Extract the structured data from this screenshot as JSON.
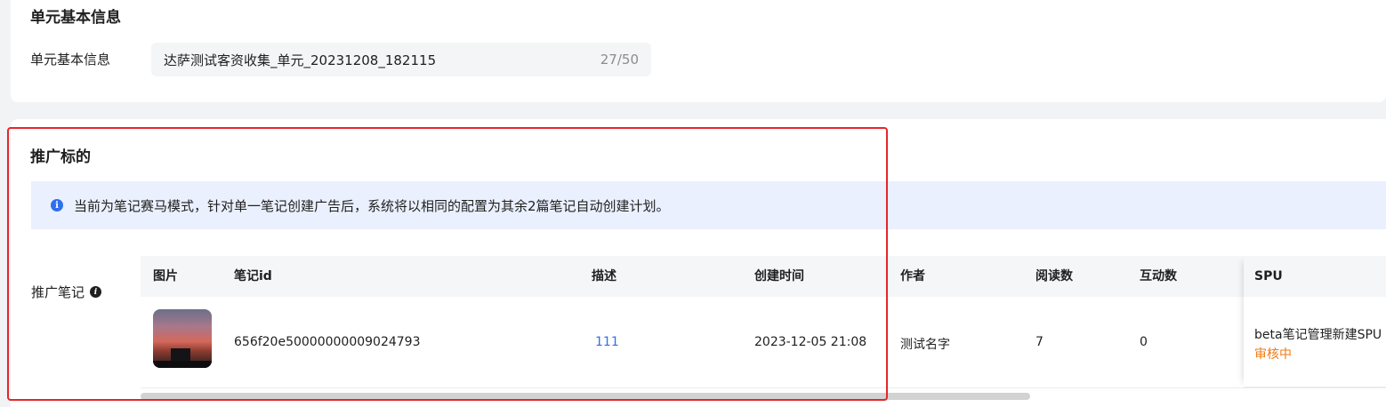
{
  "basic_section": {
    "title": "单元基本信息",
    "field_label": "单元基本信息",
    "field_value": "达萨测试客资收集_单元_20231208_182115",
    "field_counter": "27/50"
  },
  "target_section": {
    "title": "推广标的",
    "alert_text": "当前为笔记赛马模式，针对单一笔记创建广告后，系统将以相同的配置为其余2篇笔记自动创建计划。",
    "note_label": "推广笔记"
  },
  "table": {
    "headers": {
      "image": "图片",
      "note_id": "笔记id",
      "desc": "描述",
      "created": "创建时间",
      "author": "作者",
      "reads": "阅读数",
      "interactions": "互动数",
      "spu": "SPU"
    },
    "rows": [
      {
        "note_id": "656f20e50000000009024793",
        "desc": "111",
        "created": "2023-12-05 21:08",
        "author": "测试名字",
        "reads": "7",
        "interactions": "0",
        "spu_name": "beta笔记管理新建SPU",
        "spu_status": "审核中"
      }
    ]
  },
  "colors": {
    "accent": "#2f6fed",
    "warning": "#f07b16",
    "highlight": "#e5262a",
    "alert_bg": "#eaf0fd"
  },
  "icons": {
    "alert": "info-circle-icon",
    "note_label": "info-circle-icon"
  }
}
